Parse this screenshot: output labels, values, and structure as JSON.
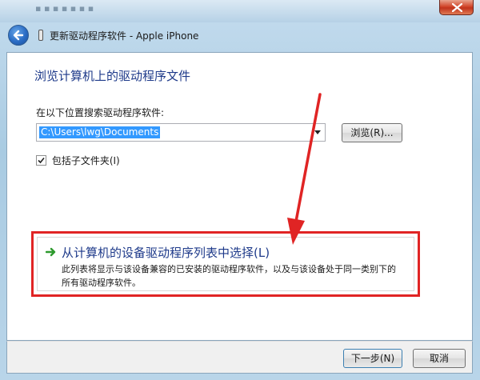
{
  "window": {
    "title": "更新驱动程序软件 - Apple iPhone",
    "faint_title": "▪ ▪ ▪ ▪ ▪ ▪ ▪"
  },
  "main": {
    "heading": "浏览计算机上的驱动程序文件",
    "search_label": "在以下位置搜索驱动程序软件:",
    "path_value": "C:\\Users\\lwg\\Documents",
    "browse_label": "浏览(R)...",
    "include_subfolders": {
      "label": "包括子文件夹(I)",
      "checked": true
    },
    "pick_option": {
      "title": "从计算机的设备驱动程序列表中选择(L)",
      "desc_line1": "此列表将显示与该设备兼容的已安装的驱动程序软件，以及与该设备处于同一类别下的",
      "desc_line2": "所有驱动程序软件。"
    }
  },
  "footer": {
    "next_label": "下一步(N)",
    "cancel_label": "取消"
  },
  "colors": {
    "link_blue": "#1e3a8a",
    "highlight_red": "#e02424",
    "selection_blue": "#3399ff",
    "arrow_green": "#2e9a2e"
  },
  "icons": {
    "back": "back-arrow-icon",
    "close": "close-icon",
    "device": "phone-icon",
    "option": "green-arrow-icon",
    "annotation": "red-pointer-arrow-icon"
  }
}
